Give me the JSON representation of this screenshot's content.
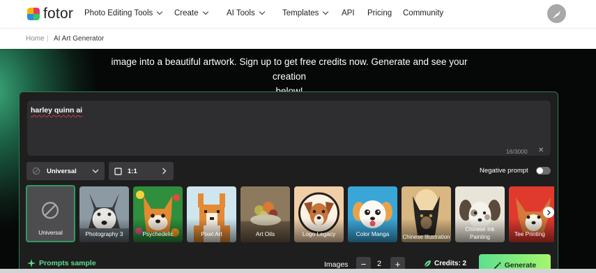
{
  "brand": {
    "name": "fotor",
    "colors": [
      "#f7b500",
      "#e83a5e",
      "#2b8bea",
      "#38c56b"
    ]
  },
  "nav": {
    "items": [
      {
        "label": "Photo Editing Tools",
        "has_dropdown": true
      },
      {
        "label": "Create",
        "has_dropdown": true
      },
      {
        "label": "AI Tools",
        "has_dropdown": true
      },
      {
        "label": "Templates",
        "has_dropdown": true
      },
      {
        "label": "API",
        "has_dropdown": false
      },
      {
        "label": "Pricing",
        "has_dropdown": false
      },
      {
        "label": "Community",
        "has_dropdown": false
      }
    ],
    "avatar_icon": "quill-icon"
  },
  "breadcrumb": {
    "home": "Home",
    "separator": "|",
    "current": "AI Art Generator"
  },
  "hero": {
    "line1": "image into a beautiful artwork. Sign up to get free credits now. Generate and see your creation",
    "line2": "below!"
  },
  "prompt": {
    "value": "harley quinn ai",
    "char_count": "16/3000",
    "clear_icon": "close-icon",
    "clear_label": "✕"
  },
  "style_select": {
    "value": "Universal",
    "icon": "disabled-circle-icon"
  },
  "ratio_select": {
    "value": "1:1",
    "icon": "square-icon"
  },
  "negative_prompt": {
    "label": "Negative prompt",
    "enabled": false
  },
  "styles": [
    {
      "label": "Universal",
      "selected": true
    },
    {
      "label": "Photography 3"
    },
    {
      "label": "Psychedelic"
    },
    {
      "label": "Pixel Art"
    },
    {
      "label": "Art Oils"
    },
    {
      "label": "Logo Legacy"
    },
    {
      "label": "Color Manga"
    },
    {
      "label": "Chinese Illustration"
    },
    {
      "label": "Chinese Ink Painting"
    },
    {
      "label": "Tee Printing"
    }
  ],
  "prompts_sample": {
    "label": "Prompts sample",
    "icon": "sparkle-icon"
  },
  "images": {
    "label": "Images",
    "count": "2",
    "decrement": "−",
    "increment": "+"
  },
  "credits": {
    "label": "Credits: 2",
    "icon": "leaf-icon"
  },
  "generate": {
    "label": "Generate",
    "icon": "magic-wand-icon",
    "color_from": "#5de08f",
    "color_to": "#a6f56d"
  }
}
